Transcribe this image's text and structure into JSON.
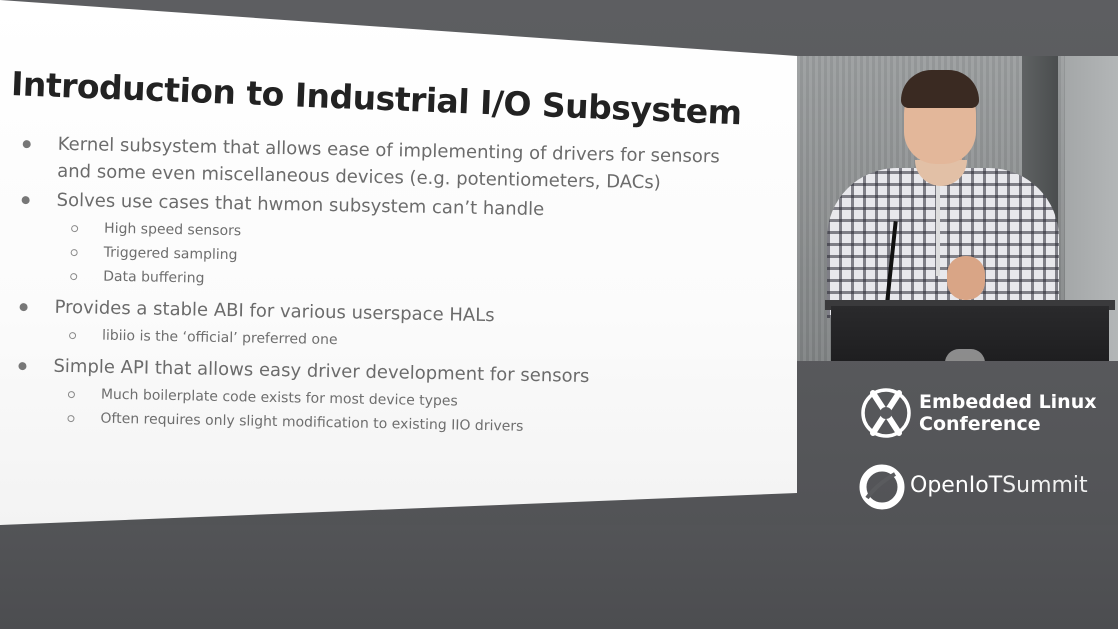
{
  "slide": {
    "title": "Introduction to Industrial I/O Subsystem",
    "bullets": [
      {
        "text": "Kernel subsystem that allows ease of implementing of drivers for sensors and some even miscellaneous devices (e.g. potentiometers, DACs)",
        "sub": []
      },
      {
        "text": "Solves use cases that hwmon subsystem can’t handle",
        "sub": [
          "High speed sensors",
          "Triggered sampling",
          "Data buffering"
        ]
      },
      {
        "text": "Provides a stable ABI for various userspace HALs",
        "sub": [
          "libiio is the ‘official’ preferred one"
        ]
      },
      {
        "text": "Simple API that allows easy driver development for sensors",
        "sub": [
          "Much boilerplate code exists for most device types",
          "Often requires only slight modification to existing IIO drivers"
        ]
      }
    ]
  },
  "conference": {
    "elc_line1": "Embedded Linux",
    "elc_line2": "Conference",
    "iot_name_a": "OpenIoT",
    "iot_name_b": "Summit"
  },
  "icons": {
    "elc_logo": "elc-logo-icon",
    "iot_logo": "openiot-logo-icon"
  },
  "colors": {
    "background": "#5a5b5e",
    "slide_bg": "#ffffff",
    "title_text": "#222222",
    "bullet_text": "#6b6b6b"
  }
}
